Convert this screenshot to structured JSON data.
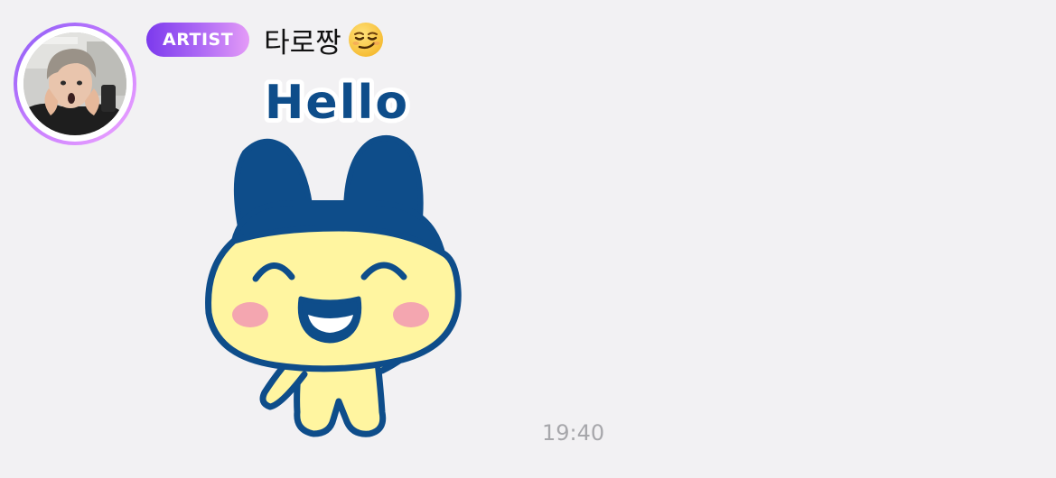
{
  "sender": {
    "role_badge": "ARTIST",
    "display_name": "타로짱",
    "name_emoji_icon": "smirking-face-icon",
    "avatar_ring_colors": [
      "#8b5cf6",
      "#c77dff",
      "#f0a6ff"
    ]
  },
  "message": {
    "type": "sticker",
    "sticker_caption": "Hello",
    "sticker_character": "tamagotchi-mametchi-waving",
    "time": "19:40"
  },
  "colors": {
    "background": "#f2f1f3",
    "sticker_navy": "#0e4d8a",
    "sticker_yellow": "#fff5a0",
    "sticker_cheek": "#f4a6b0",
    "timestamp": "#a7a7ab",
    "badge_gradient": [
      "#7c3aed",
      "#b06cf5",
      "#e49bf7"
    ]
  }
}
